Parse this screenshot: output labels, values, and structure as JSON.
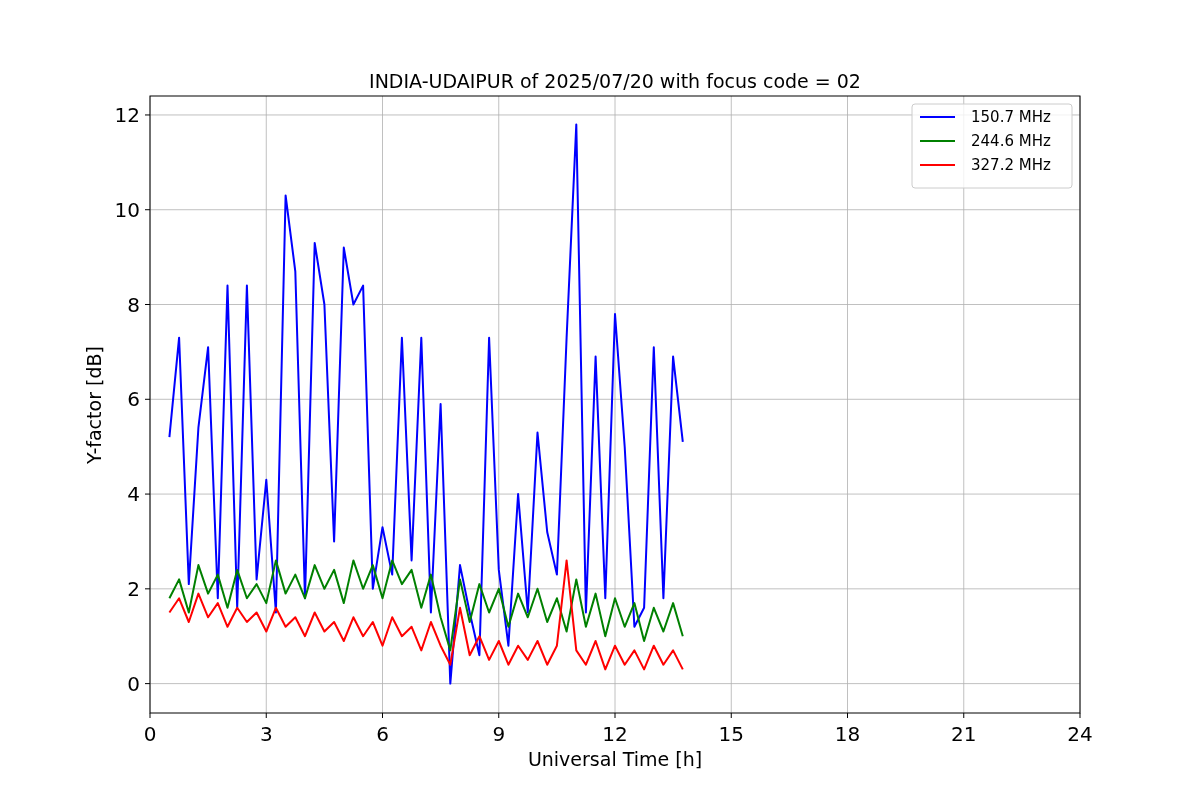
{
  "figure": {
    "chart_data": {
      "type": "line",
      "title": "INDIA-UDAIPUR of 2025/07/20 with focus code = 02",
      "xlabel": "Universal Time [h]",
      "ylabel": "Y-factor [dB]",
      "x": [
        0.5,
        0.75,
        1.0,
        1.25,
        1.5,
        1.75,
        2.0,
        2.25,
        2.5,
        2.75,
        3.0,
        3.25,
        3.5,
        3.75,
        4.0,
        4.25,
        4.5,
        4.75,
        5.0,
        5.25,
        5.5,
        5.75,
        6.0,
        6.25,
        6.5,
        6.75,
        7.0,
        7.25,
        7.5,
        7.75,
        8.0,
        8.25,
        8.5,
        8.75,
        9.0,
        9.25,
        9.5,
        9.75,
        10.0,
        10.25,
        10.5,
        10.75,
        11.0,
        11.25,
        11.5,
        11.75,
        12.0,
        12.25,
        12.5,
        12.75,
        13.0,
        13.25,
        13.5,
        13.75
      ],
      "series": [
        {
          "name": "150.7 MHz",
          "color": "#0000ff",
          "values": [
            5.2,
            7.3,
            2.1,
            5.4,
            7.1,
            1.8,
            8.4,
            1.6,
            8.4,
            2.2,
            4.3,
            1.5,
            10.3,
            8.7,
            1.8,
            9.3,
            8.0,
            3.0,
            9.2,
            8.0,
            8.4,
            2.0,
            3.3,
            2.3,
            7.3,
            2.6,
            7.3,
            1.5,
            5.9,
            0.0,
            2.5,
            1.5,
            0.6,
            7.3,
            2.4,
            0.8,
            4.0,
            1.5,
            5.3,
            3.2,
            2.3,
            7.3,
            11.8,
            1.5,
            6.9,
            1.8,
            7.8,
            5.0,
            1.2,
            1.6,
            7.1,
            1.8,
            6.9,
            5.1
          ]
        },
        {
          "name": "244.6 MHz",
          "color": "#008000",
          "values": [
            1.8,
            2.2,
            1.5,
            2.5,
            1.9,
            2.3,
            1.6,
            2.4,
            1.8,
            2.1,
            1.7,
            2.6,
            1.9,
            2.3,
            1.8,
            2.5,
            2.0,
            2.4,
            1.7,
            2.6,
            2.0,
            2.5,
            1.8,
            2.6,
            2.1,
            2.4,
            1.6,
            2.3,
            1.4,
            0.7,
            2.2,
            1.3,
            2.1,
            1.5,
            2.0,
            1.2,
            1.9,
            1.4,
            2.0,
            1.3,
            1.8,
            1.1,
            2.2,
            1.2,
            1.9,
            1.0,
            1.8,
            1.2,
            1.7,
            0.9,
            1.6,
            1.1,
            1.7,
            1.0
          ]
        },
        {
          "name": "327.2 MHz",
          "color": "#ff0000",
          "values": [
            1.5,
            1.8,
            1.3,
            1.9,
            1.4,
            1.7,
            1.2,
            1.6,
            1.3,
            1.5,
            1.1,
            1.6,
            1.2,
            1.4,
            1.0,
            1.5,
            1.1,
            1.3,
            0.9,
            1.4,
            1.0,
            1.3,
            0.8,
            1.4,
            1.0,
            1.2,
            0.7,
            1.3,
            0.8,
            0.4,
            1.6,
            0.6,
            1.0,
            0.5,
            0.9,
            0.4,
            0.8,
            0.5,
            0.9,
            0.4,
            0.8,
            2.6,
            0.7,
            0.4,
            0.9,
            0.3,
            0.8,
            0.4,
            0.7,
            0.3,
            0.8,
            0.4,
            0.7,
            0.3
          ]
        }
      ],
      "grid": true,
      "legend": true,
      "xlim": [
        0,
        24
      ],
      "ylim": [
        -0.62,
        12.4
      ],
      "xticks": [
        0,
        3,
        6,
        9,
        12,
        15,
        18,
        21,
        24
      ],
      "yticks": [
        0,
        2,
        4,
        6,
        8,
        10,
        12
      ]
    }
  }
}
